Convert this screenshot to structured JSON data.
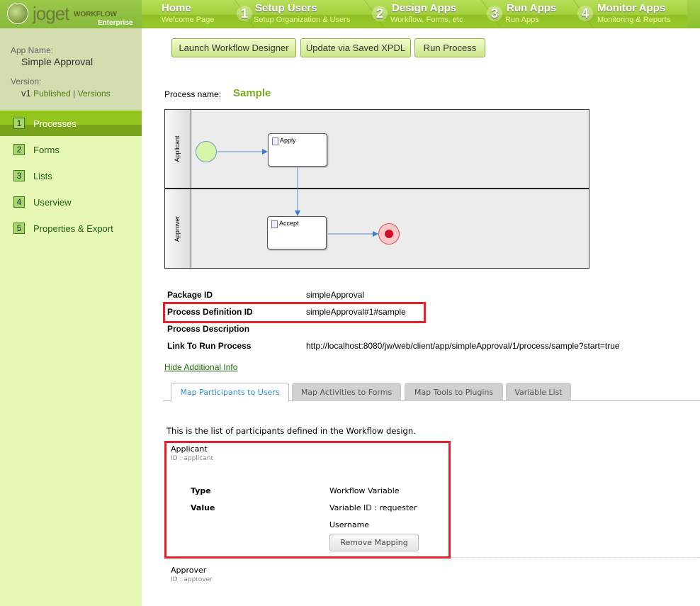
{
  "logo": {
    "brand": "joget",
    "workflow": "WORKFLOW",
    "edition": "Enterprise"
  },
  "nav": [
    {
      "num": "",
      "title": "Home",
      "sub": "Welcome Page"
    },
    {
      "num": "1",
      "title": "Setup Users",
      "sub": "Setup Organization & Users"
    },
    {
      "num": "2",
      "title": "Design Apps",
      "sub": "Workflow, Forms, etc"
    },
    {
      "num": "3",
      "title": "Run Apps",
      "sub": "Run Apps"
    },
    {
      "num": "4",
      "title": "Monitor Apps",
      "sub": "Monitoring & Reports"
    }
  ],
  "app": {
    "name_label": "App Name:",
    "name": "Simple Approval",
    "version_label": "Version:",
    "version": "v1",
    "published": "Published",
    "sep": "|",
    "versions": "Versions"
  },
  "sidebar": [
    {
      "num": "1",
      "label": "Processes"
    },
    {
      "num": "2",
      "label": "Forms"
    },
    {
      "num": "3",
      "label": "Lists"
    },
    {
      "num": "4",
      "label": "Userview"
    },
    {
      "num": "5",
      "label": "Properties & Export"
    }
  ],
  "toolbar": {
    "launch": "Launch Workflow Designer",
    "update": "Update via Saved XPDL",
    "run": "Run Process"
  },
  "process": {
    "name_label": "Process name:",
    "name": "Sample"
  },
  "diagram": {
    "lanes": [
      "Applicant",
      "Approver"
    ],
    "activities": [
      "Apply",
      "Accept"
    ]
  },
  "info": [
    {
      "label": "Package ID",
      "value": "simpleApproval"
    },
    {
      "label": "Process Definition ID",
      "value": "simpleApproval#1#sample"
    },
    {
      "label": "Process Description",
      "value": ""
    },
    {
      "label": "Link To Run Process",
      "value": "http://localhost:8080/jw/web/client/app/simpleApproval/1/process/sample?start=true"
    }
  ],
  "hide_info": "Hide Additional Info",
  "tabs": [
    "Map Participants to Users",
    "Map Activities to Forms",
    "Map Tools to Plugins",
    "Variable List"
  ],
  "participants_intro": "This is the list of participants defined in the Workflow design.",
  "participants": [
    {
      "name": "Applicant",
      "id": "ID : applicant",
      "type_label": "Type",
      "type": "Workflow Variable",
      "value_label": "Value",
      "value": "Variable ID : requester",
      "username": "Username",
      "remove": "Remove Mapping"
    },
    {
      "name": "Approver",
      "id": "ID : approver"
    }
  ]
}
